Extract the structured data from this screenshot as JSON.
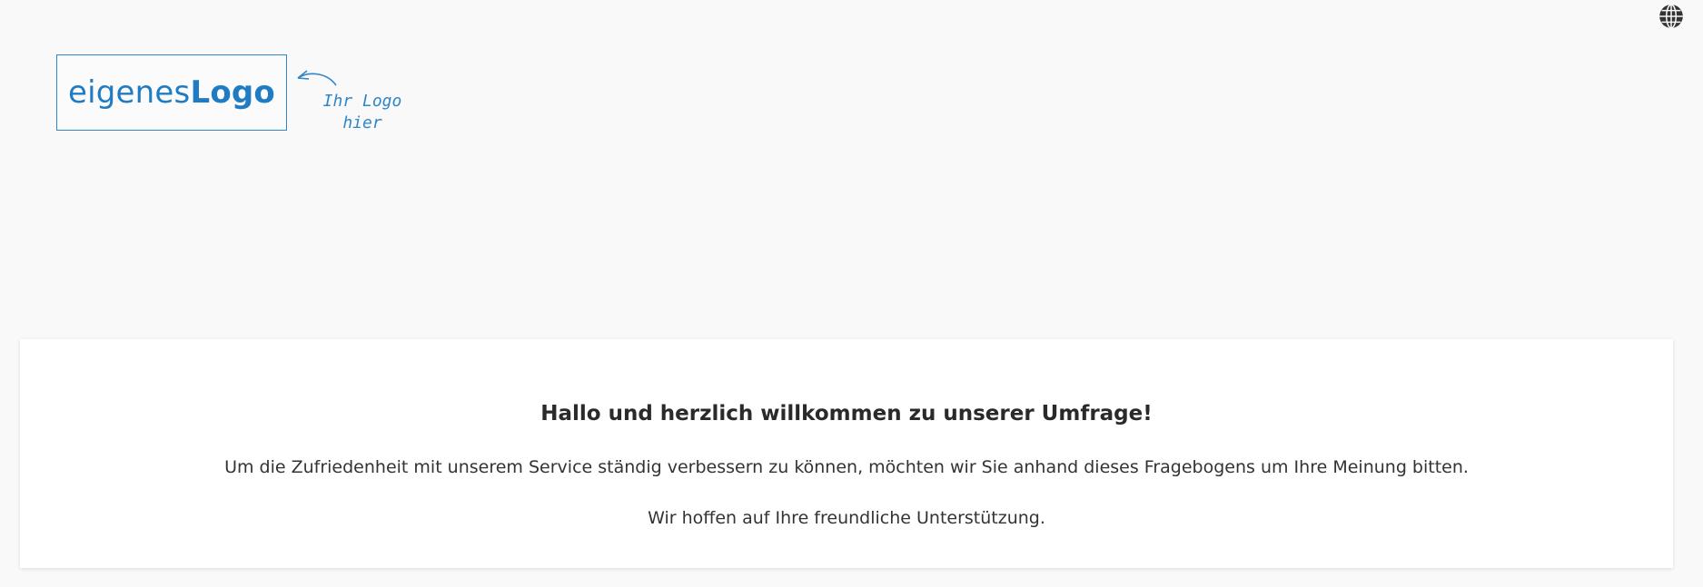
{
  "language_button": {
    "icon": "globe-icon"
  },
  "logo": {
    "text_light": "eigenes",
    "text_bold": "Logo",
    "note_line1": "Ihr Logo",
    "note_line2": "hier",
    "brand_color": "#1f7cc3"
  },
  "welcome": {
    "title": "Hallo und herzlich willkommen zu unserer Umfrage!",
    "paragraph1": "Um die Zufriedenheit mit unserem Service ständig verbessern zu können, möchten wir Sie anhand dieses Fragebogens um Ihre Meinung bitten.",
    "paragraph2": "Wir hoffen auf Ihre freundliche Unterstützung."
  }
}
